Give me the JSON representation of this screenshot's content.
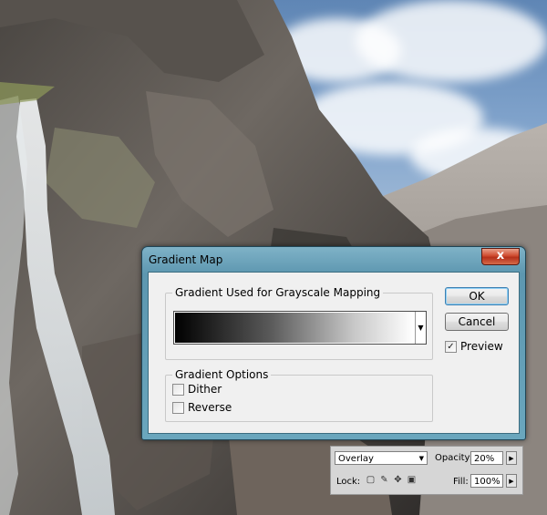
{
  "dialog": {
    "title": "Gradient Map",
    "close_label": "x",
    "gradient_group_label": "Gradient Used for Grayscale Mapping",
    "gradient_dropdown_icon": "triangle-down-icon",
    "options_group_label": "Gradient Options",
    "dither_label": "Dither",
    "dither_checked": false,
    "reverse_label": "Reverse",
    "reverse_checked": false,
    "ok_label": "OK",
    "cancel_label": "Cancel",
    "preview_label": "Preview",
    "preview_checked": true
  },
  "layers_panel": {
    "blend_mode": "Overlay",
    "opacity_label": "Opacity:",
    "opacity_value": "20%",
    "lock_label": "Lock:",
    "fill_label": "Fill:",
    "fill_value": "100%"
  },
  "colors": {
    "titlebar": "#6aa6bd",
    "close_button": "#c8452b",
    "dialog_body": "#f0f0f0"
  }
}
